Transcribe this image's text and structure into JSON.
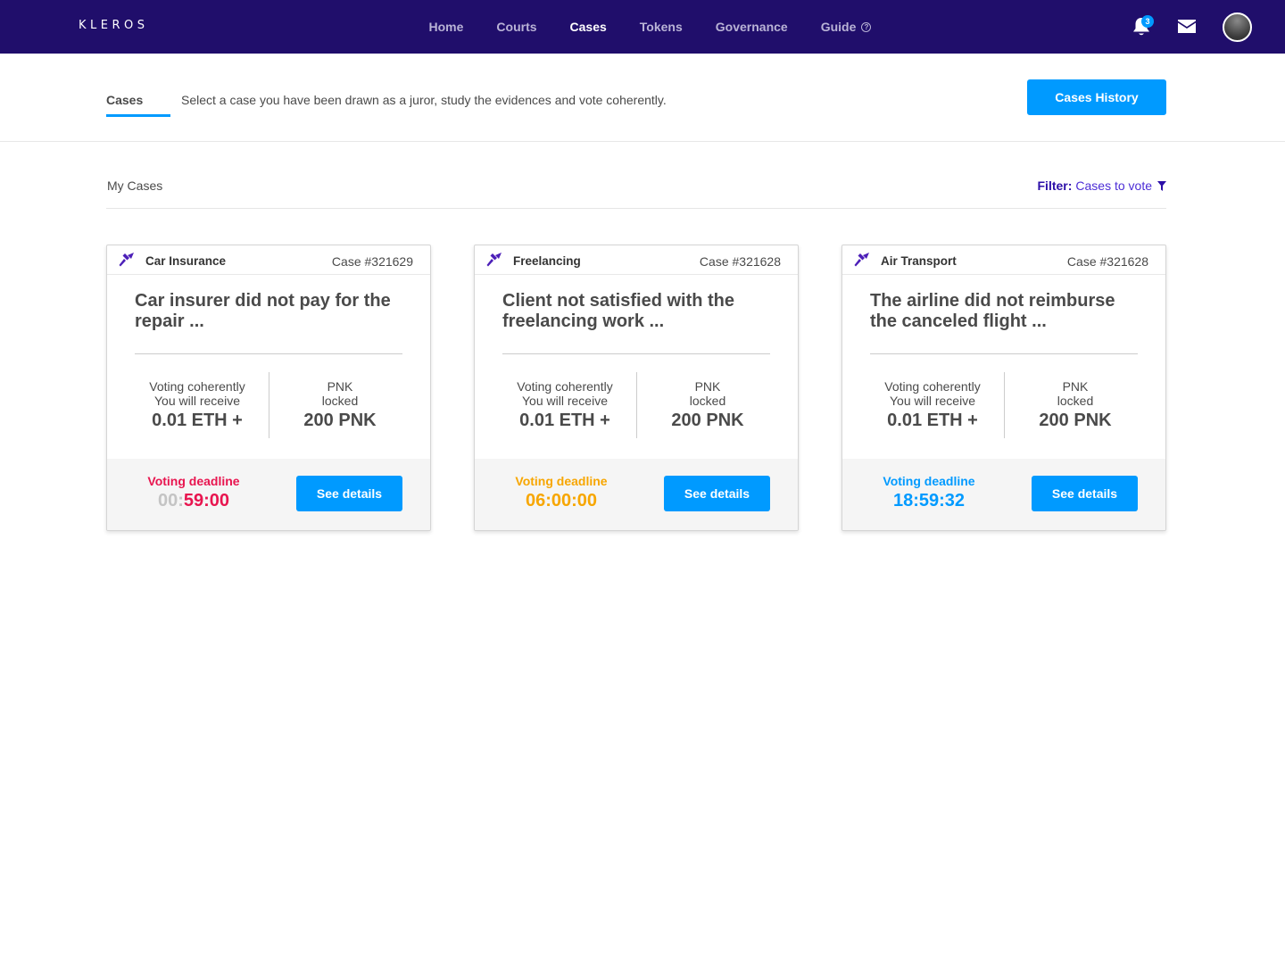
{
  "app": {
    "logo": "KLEROS"
  },
  "nav": {
    "items": [
      {
        "label": "Home",
        "active": false
      },
      {
        "label": "Courts",
        "active": false
      },
      {
        "label": "Cases",
        "active": true
      },
      {
        "label": "Tokens",
        "active": false
      },
      {
        "label": "Governance",
        "active": false
      },
      {
        "label": "Guide",
        "active": false
      }
    ],
    "notifications_count": "3",
    "icons": [
      "help-icon",
      "bell-icon",
      "mail-icon",
      "avatar"
    ]
  },
  "subheader": {
    "tab": "Cases",
    "description": "Select a case you have been drawn as a juror, study the evidences and vote coherently.",
    "history_button": "Cases History"
  },
  "list": {
    "title": "My Cases",
    "filter_key": "Filter:",
    "filter_value": "Cases to vote",
    "filter_icon": "funnel-icon"
  },
  "colors": {
    "nav_bg": "#200e6b",
    "accent": "#009aff",
    "brand_purple": "#4c2dd6",
    "deadline_urgent": "#e8154f",
    "deadline_warning": "#f7a600",
    "deadline_normal": "#009aff"
  },
  "cases": [
    {
      "court": "Car Insurance",
      "case_number": "Case #321629",
      "title": "Car insurer did not pay for the repair ...",
      "reward_line1": "Voting coherently",
      "reward_line2": "You will receive",
      "reward_value": "0.01 ETH +",
      "locked_line1": "PNK",
      "locked_line2": "locked",
      "locked_value": "200 PNK",
      "deadline_label": "Voting deadline",
      "deadline_time_dim": "00:",
      "deadline_time": "59:00",
      "deadline_color": "#e8154f",
      "button": "See details"
    },
    {
      "court": "Freelancing",
      "case_number": "Case #321628",
      "title": "Client not satisfied with the freelancing work ...",
      "reward_line1": "Voting coherently",
      "reward_line2": "You will receive",
      "reward_value": "0.01 ETH +",
      "locked_line1": "PNK",
      "locked_line2": "locked",
      "locked_value": "200 PNK",
      "deadline_label": "Voting deadline",
      "deadline_time_dim": "",
      "deadline_time": "06:00:00",
      "deadline_color": "#f7a600",
      "button": "See details"
    },
    {
      "court": "Air Transport",
      "case_number": "Case #321628",
      "title": "The airline did not reimburse the canceled flight ...",
      "reward_line1": "Voting coherently",
      "reward_line2": "You will receive",
      "reward_value": "0.01 ETH +",
      "locked_line1": "PNK",
      "locked_line2": "locked",
      "locked_value": "200 PNK",
      "deadline_label": "Voting deadline",
      "deadline_time_dim": "",
      "deadline_time": "18:59:32",
      "deadline_color": "#009aff",
      "button": "See details"
    }
  ]
}
